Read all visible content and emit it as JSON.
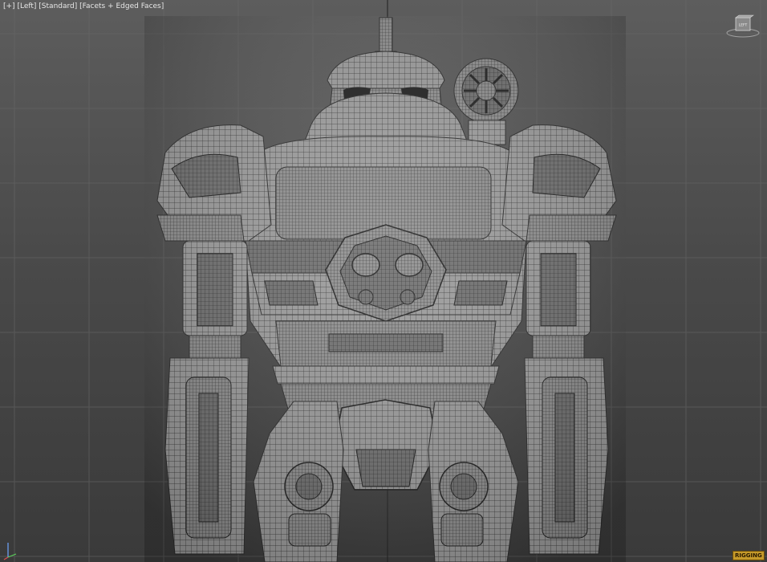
{
  "viewport": {
    "menu_plus": "[+]",
    "point_of_view": "[Left]",
    "shading_preset": "[Standard]",
    "display_mode": "[Facets + Edged Faces]"
  },
  "viewcube": {
    "face_label": "LEFT"
  },
  "badge": {
    "text": "RIGGING"
  },
  "colors": {
    "background_top": "#5d5d5d",
    "background_bottom": "#3a3a3a",
    "grid_line": "#6a6a6a",
    "mesh_fill": "#9a9a9a",
    "wireframe": "#2b2b2b",
    "label_text": "#e6e6e6",
    "badge": "#c69a2a"
  },
  "icons": [
    "viewcube-icon",
    "axis-tripod-icon"
  ]
}
